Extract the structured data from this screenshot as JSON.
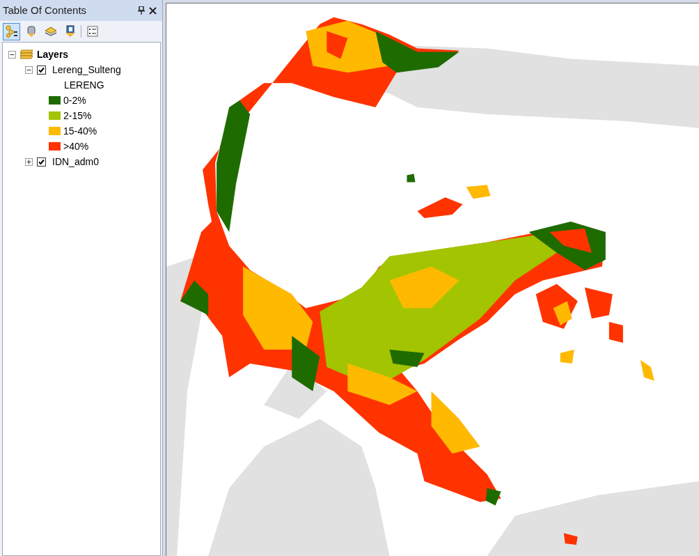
{
  "panel": {
    "title": "Table Of Contents"
  },
  "tools": [
    {
      "kind": "drawing-order",
      "selected": true
    },
    {
      "kind": "source",
      "selected": false
    },
    {
      "kind": "visibility",
      "selected": false
    },
    {
      "kind": "selection",
      "selected": false
    },
    {
      "kind": "options",
      "selected": false
    }
  ],
  "tree": {
    "label": "Layers",
    "expanded": true,
    "children": [
      {
        "label": "Lereng_Sulteng",
        "checked": true,
        "expanded": true,
        "legend": {
          "heading": "LERENG",
          "classes": [
            {
              "label": "0-2%",
              "color": "#1e6b00"
            },
            {
              "label": "2-15%",
              "color": "#a3c400"
            },
            {
              "label": "15-40%",
              "color": "#ffb900"
            },
            {
              "label": ">40%",
              "color": "#ff3300"
            }
          ]
        }
      },
      {
        "label": "IDN_adm0",
        "checked": true,
        "expanded": false
      }
    ]
  }
}
